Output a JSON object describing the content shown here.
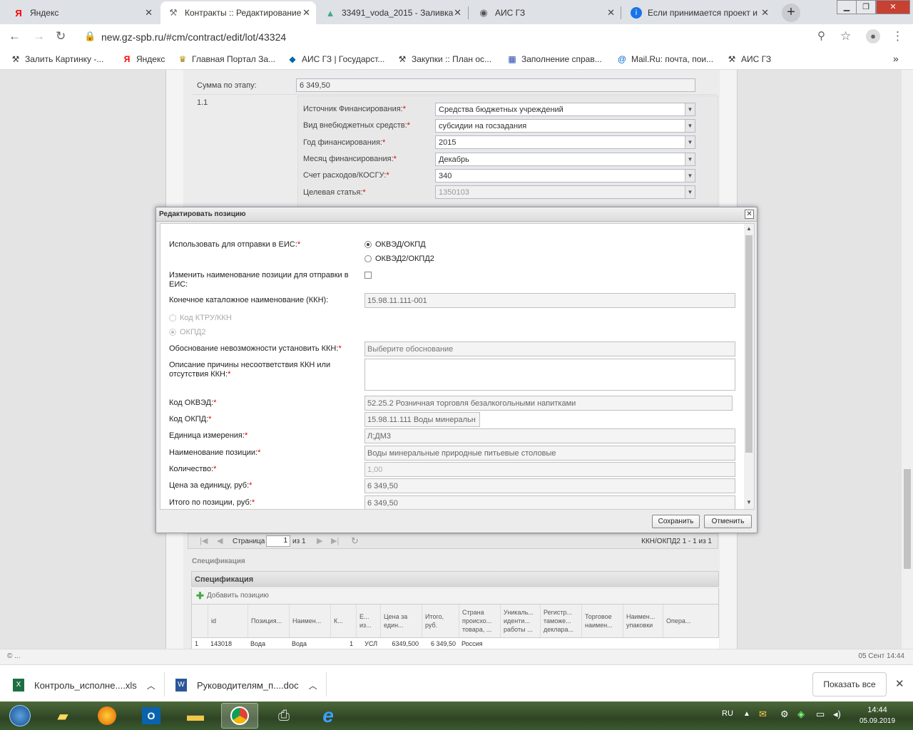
{
  "browser": {
    "tabs": [
      {
        "title": "Яндекс",
        "icon": "yandex-icon"
      },
      {
        "title": "Контракты :: Редактирование",
        "icon": "hammer-icon"
      },
      {
        "title": "33491_voda_2015 - Заливка",
        "icon": "image-icon"
      },
      {
        "title": "АИС ГЗ",
        "icon": "globe-icon"
      },
      {
        "title": "Если принимается проект и",
        "icon": "info-icon"
      }
    ],
    "url": "new.gz-spb.ru/#cm/contract/edit/lot/43324",
    "bookmarks": [
      "Залить Картинку -...",
      "Яндекс",
      "Главная Портал За...",
      "АИС ГЗ | Государст...",
      "Закупки :: План ос...",
      "Заполнение справ...",
      "Mail.Ru: почта, пои...",
      "АИС ГЗ"
    ],
    "bookmarks_more": "»"
  },
  "background_form": {
    "stage_sum_label": "Сумма по этапу:",
    "stage_sum_value": "6 349,50",
    "row_number": "1.1",
    "fields": [
      {
        "label": "Источник Финансирования:",
        "value": "Средства бюджетных учреждений"
      },
      {
        "label": "Вид внебюджетных средств:",
        "value": "субсидии на госзадания"
      },
      {
        "label": "Год финансирования:",
        "value": "2015"
      },
      {
        "label": "Месяц финансирования:",
        "value": "Декабрь"
      },
      {
        "label": "Счет расходов/КОСГУ:",
        "value": "340"
      },
      {
        "label": "Целевая статья:",
        "value": "1350103"
      }
    ],
    "pager": {
      "page_label": "Страница",
      "page_value": "1",
      "of_label": "из 1",
      "summary": "ККН/ОКПД2 1 - 1 из 1"
    },
    "spec_section_title": "Спецификация",
    "spec_panel_title": "Спецификация",
    "add_position": "Добавить позицию",
    "columns": [
      "id",
      "Позиция...",
      "Наимен...",
      "К...",
      "Е... из...",
      "Цена за един...",
      "Итого, руб.",
      "Страна происхо... товара, ...",
      "Уникаль... иденти... работы ...",
      "Регистр... таможе... деклара...",
      "Торговое наимен...",
      "Наимен... упаковки",
      "Опера..."
    ],
    "row": [
      "1",
      "143018",
      "Вода",
      "Вода",
      "1",
      "УСЛ",
      "6349,500",
      "6 349,50",
      "Россия"
    ]
  },
  "modal": {
    "title": "Редактировать позицию",
    "use_for_eis_label": "Использовать для отправки в ЕИС:",
    "radio_okved": "ОКВЭД/ОКПД",
    "radio_okved2": "ОКВЭД2/ОКПД2",
    "rename_label": "Изменить наименование позиции для отправки в ЕИС:",
    "kkn_label": "Конечное каталожное наименование (ККН):",
    "kkn_value": "15.98.11.111-001",
    "radio_ktru": "Код КТРУ/ККН",
    "radio_okpd2": "ОКПД2",
    "justification_label": "Обоснование невозможности установить ККН:",
    "justification_placeholder": "Выберите обоснование",
    "description_label": "Описание причины несоответствия ККН или отсутствия ККН:",
    "description_value": "",
    "okved_label": "Код ОКВЭД:",
    "okved_value": "52.25.2 Розничная торговля безалкогольными напитками",
    "okpd_label": "Код ОКПД:",
    "okpd_value": "15.98.11.111 Воды минеральн",
    "unit_label": "Единица измерения:",
    "unit_value": "Л;ДМ3",
    "name_label": "Наименование позиции:",
    "name_value": "Воды минеральные природные питьевые столовые",
    "qty_label": "Количество:",
    "qty_value": "1,00",
    "price_label": "Цена за единицу, руб:",
    "price_value": "6 349,50",
    "total_label": "Итого по позиции, руб:",
    "total_value": "6 349,50",
    "save": "Сохранить",
    "cancel": "Отменить",
    "required_mark": "*"
  },
  "status": {
    "left": "© ...",
    "right": "05 Сент 14:44"
  },
  "downloads": {
    "items": [
      {
        "name": "Контроль_исполне....xls",
        "icon": "excel-icon"
      },
      {
        "name": "Руководителям_п....doc",
        "icon": "word-icon"
      }
    ],
    "show_all": "Показать все"
  },
  "taskbar": {
    "lang": "RU",
    "time": "14:44",
    "date": "05.09.2019"
  }
}
